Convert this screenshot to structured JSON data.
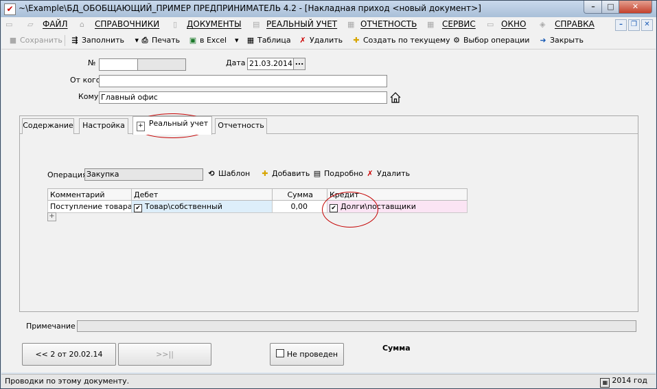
{
  "window": {
    "title": "~\\Example\\БД_ОБОБЩАЮЩИЙ_ПРИМЕР  ПРЕДПРИНИМАТЕЛЬ 4.2 - [Накладная приход <новый документ>]",
    "min_glyph": "–",
    "max_glyph": "□",
    "close_glyph": "✕"
  },
  "menu": {
    "items": [
      "ФАЙЛ",
      "СПРАВОЧНИКИ",
      "ДОКУМЕНТЫ",
      "РЕАЛЬНЫЙ УЧЕТ",
      "ОТЧЕТНОСТЬ",
      "СЕРВИС",
      "ОКНО",
      "СПРАВКА"
    ],
    "mdi_min": "–",
    "mdi_restore": "❐",
    "mdi_close": "✕"
  },
  "toolbar": {
    "save": "Сохранить",
    "fill": "Заполнить",
    "print": "Печать",
    "excel": "в Excel",
    "table": "Таблица",
    "delete": "Удалить",
    "create_from": "Создать по текущему",
    "choose_op": "Выбор операции",
    "close": "Закрыть"
  },
  "form": {
    "number_label": "№",
    "number_value": "",
    "date_label": "Дата",
    "date_value": "21.03.2014",
    "date_btn": "...",
    "from_label": "От кого",
    "from_value": "",
    "to_label": "Кому",
    "to_value": "Главный офис"
  },
  "tabs": [
    {
      "label": "Содержание"
    },
    {
      "label": "Настройка"
    },
    {
      "label": "Реальный учет"
    },
    {
      "label": "Отчетность"
    }
  ],
  "operation": {
    "label": "Операция",
    "value": "Закупка",
    "template": "Шаблон",
    "add": "Добавить",
    "details": "Подробно",
    "delete": "Удалить"
  },
  "grid": {
    "columns": [
      "Комментарий",
      "Дебет",
      "Сумма",
      "Кредит"
    ],
    "rows": [
      {
        "comment": "Поступление товара",
        "debit": "Товар\\собственный",
        "sum": "0,00",
        "credit": "Долги\\поставщики",
        "debit_checked": "✔",
        "credit_checked": "✔"
      }
    ],
    "add_row": "+"
  },
  "note": {
    "label": "Примечание",
    "value": ""
  },
  "footer": {
    "prev_btn": "<< 2 от 20.02.14",
    "next_btn": ">>||",
    "not_posted": "Не проведен",
    "sum_label": "Сумма"
  },
  "status": {
    "text": "Проводки по этому документу.",
    "year": "2014 год"
  },
  "colors": {
    "debit_cell": "#ddeefa",
    "credit_cell": "#fbe4f4",
    "highlight_ellipse": "#c40000"
  }
}
